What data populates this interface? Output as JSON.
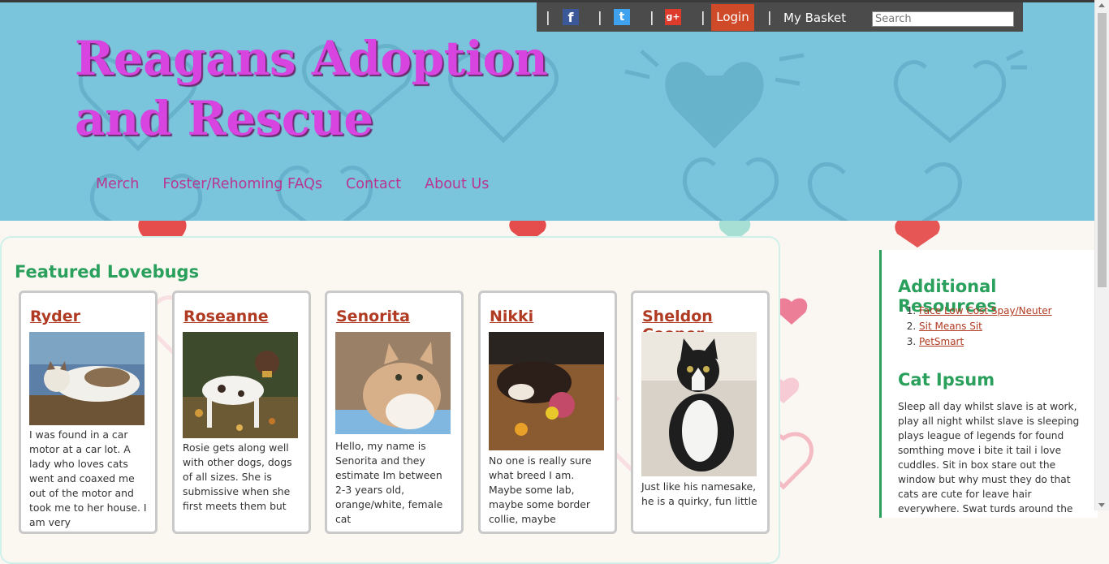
{
  "site": {
    "title_line1": "Reagans Adoption",
    "title_line2": "and Rescue"
  },
  "nav": {
    "items": [
      "Merch",
      "Foster/Rehoming FAQs",
      "Contact",
      "About Us"
    ]
  },
  "utility": {
    "separator": "|",
    "facebook_glyph": "f",
    "twitter_glyph": "t",
    "google_glyph": "g+",
    "login_label": "Login",
    "basket_label": "My Basket",
    "search_placeholder": "Search"
  },
  "featured": {
    "title": "Featured Lovebugs",
    "cards": [
      {
        "name": "Ryder",
        "text": "I was found in a car motor at a car lot. A lady who loves cats went and coaxed me out of the motor and took me to her house. I am very"
      },
      {
        "name": "Roseanne",
        "text": "Rosie gets along well with other dogs, dogs of all sizes. She is submissive when she first meets them but"
      },
      {
        "name": "Senorita",
        "text": "Hello, my name is Senorita and they estimate Im between 2-3 years old, orange/white, female cat"
      },
      {
        "name": "Nikki",
        "text": "No one is really sure what breed I am. Maybe some lab, maybe some border collie, maybe"
      },
      {
        "name": "Sheldon Cooper",
        "text": "Just like his namesake, he is a quirky, fun little"
      }
    ]
  },
  "sidebar": {
    "resources_title": "Additional Resources",
    "links": [
      "Face Low Cost Spay/Neuter",
      "Sit Means Sit",
      "PetSmart"
    ],
    "ipsum_title": "Cat Ipsum",
    "ipsum_text": "Sleep all day whilst slave is at work, play all night whilst slave is sleeping plays league of legends for found somthing move i bite it tail i love cuddles. Sit in box stare out the window but why must they do that cats are cute for leave hair everywhere. Swat turds around the house. Meow to be let out"
  },
  "colors": {
    "header_bg": "#7ac4dc",
    "title": "#d744e0",
    "nav_link": "#b8378f",
    "login_bg": "#cf4a28",
    "accent_green": "#2aa05c",
    "link": "#b03a22"
  }
}
